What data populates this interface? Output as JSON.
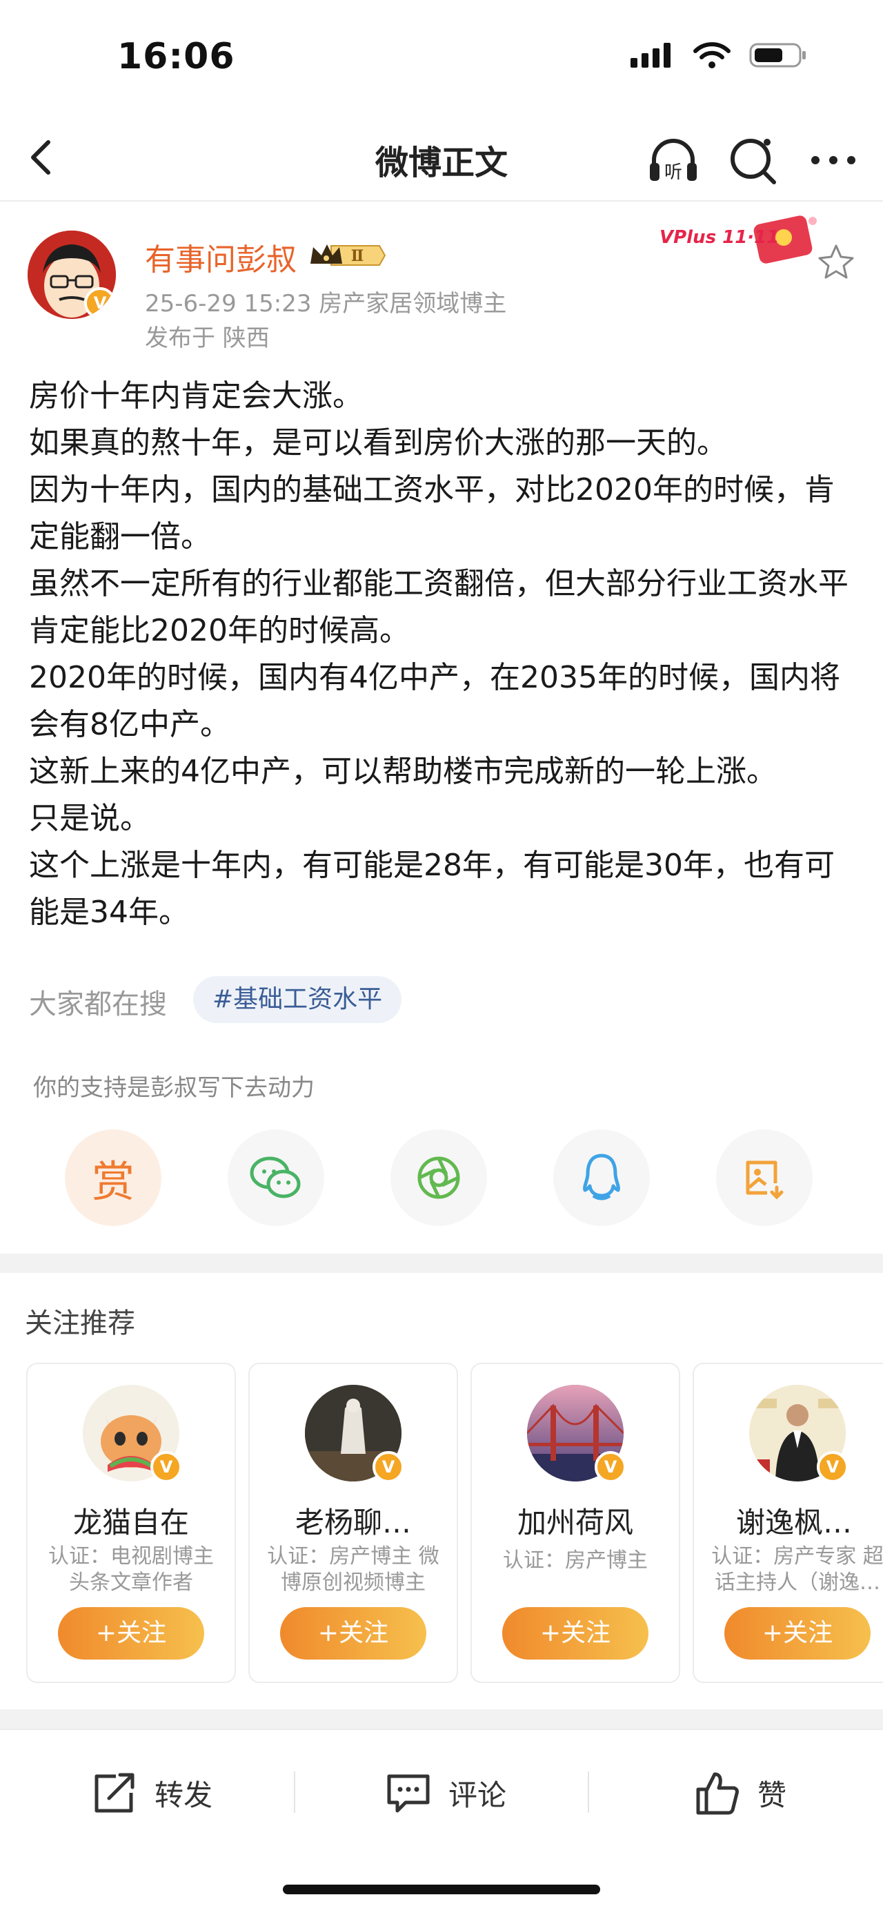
{
  "status_bar": {
    "time": "16:06"
  },
  "nav": {
    "title": "微博正文"
  },
  "author": {
    "name": "有事问彭叔",
    "level_badge": "Ⅱ",
    "meta": "25-6-29 15:23  房产家居领域博主",
    "location": "发布于 陕西",
    "verified_mark": "V"
  },
  "ad": {
    "label": "VPlus 11·11"
  },
  "post": {
    "paragraphs": [
      "房价十年内肯定会大涨。",
      "如果真的熬十年，是可以看到房价大涨的那一天的。",
      "因为十年内，国内的基础工资水平，对比2020年的时候，肯定能翻一倍。",
      "虽然不一定所有的行业都能工资翻倍，但大部分行业工资水平肯定能比2020年的时候高。",
      "2020年的时候，国内有4亿中产，在2035年的时候，国内将会有8亿中产。",
      "这新上来的4亿中产，可以帮助楼市完成新的一轮上涨。",
      "只是说。",
      "这个上涨是十年内，有可能是28年，有可能是30年，也有可能是34年。"
    ]
  },
  "search": {
    "label": "大家都在搜",
    "hashtag": "#基础工资水平"
  },
  "support": {
    "text": "你的支持是彭叔写下去动力",
    "reward_label": "赏"
  },
  "share_icons": [
    "reward-icon",
    "wechat-icon",
    "moments-icon",
    "qq-icon",
    "save-image-icon"
  ],
  "recommend": {
    "title": "关注推荐",
    "follow_label": "+关注",
    "cards": [
      {
        "name": "龙猫自在",
        "cert": "认证：电视剧博主 头条文章作者"
      },
      {
        "name": "老杨聊…",
        "cert": "认证：房产博主 微博原创视频博主"
      },
      {
        "name": "加州荷风",
        "cert": "认证：房产博主"
      },
      {
        "name": "谢逸枫…",
        "cert": "认证：房产专家 超话主持人（谢逸…"
      }
    ]
  },
  "actions": {
    "repost": "转发",
    "comment": "评论",
    "like": "赞"
  },
  "colors": {
    "accent": "#e8632a",
    "follow_gradient_start": "#f08a2c",
    "follow_gradient_end": "#f6c04d",
    "hashtag_text": "#3a5d96"
  }
}
